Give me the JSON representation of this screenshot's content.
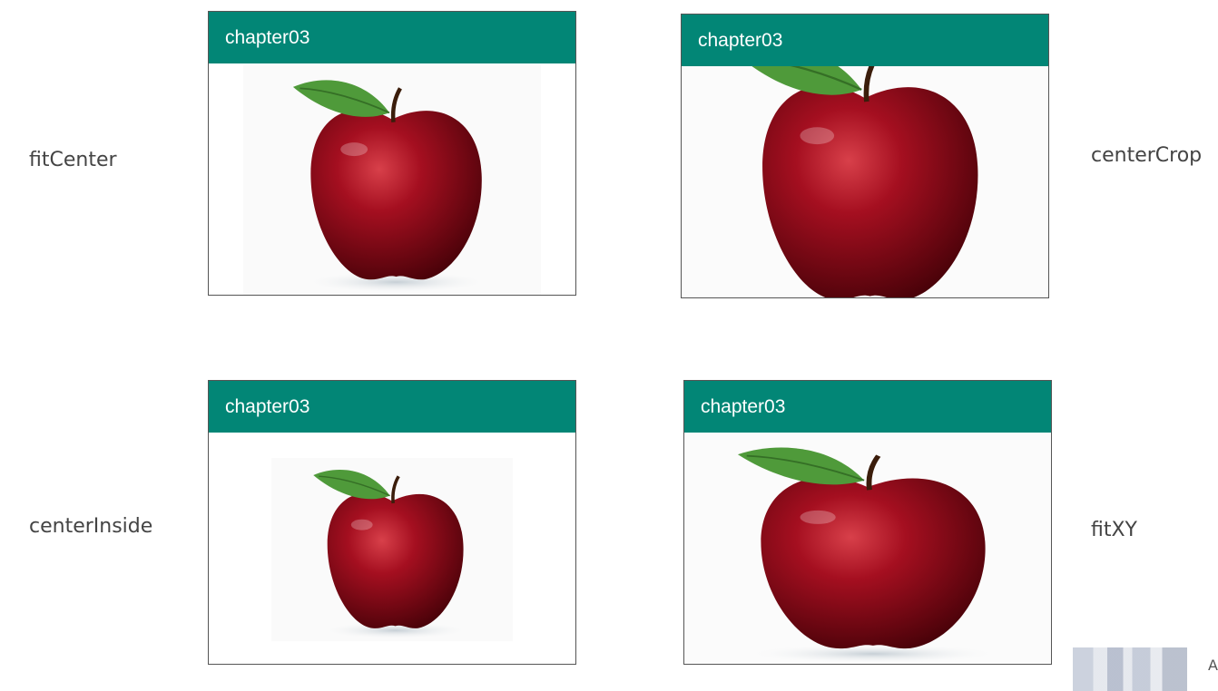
{
  "labels": {
    "fit_center": "fitCenter",
    "center_crop": "centerCrop",
    "center_inside": "centerInside",
    "fit_xy": "fitXY"
  },
  "panels": [
    {
      "title": "chapter03"
    },
    {
      "title": "chapter03"
    },
    {
      "title": "chapter03"
    },
    {
      "title": "chapter03"
    }
  ],
  "colors": {
    "app_bar": "#028676",
    "apple_dark": "#5a0410",
    "apple_mid": "#9e0d1c",
    "leaf": "#4f9a3a"
  },
  "watermark": {
    "letter": "A"
  }
}
